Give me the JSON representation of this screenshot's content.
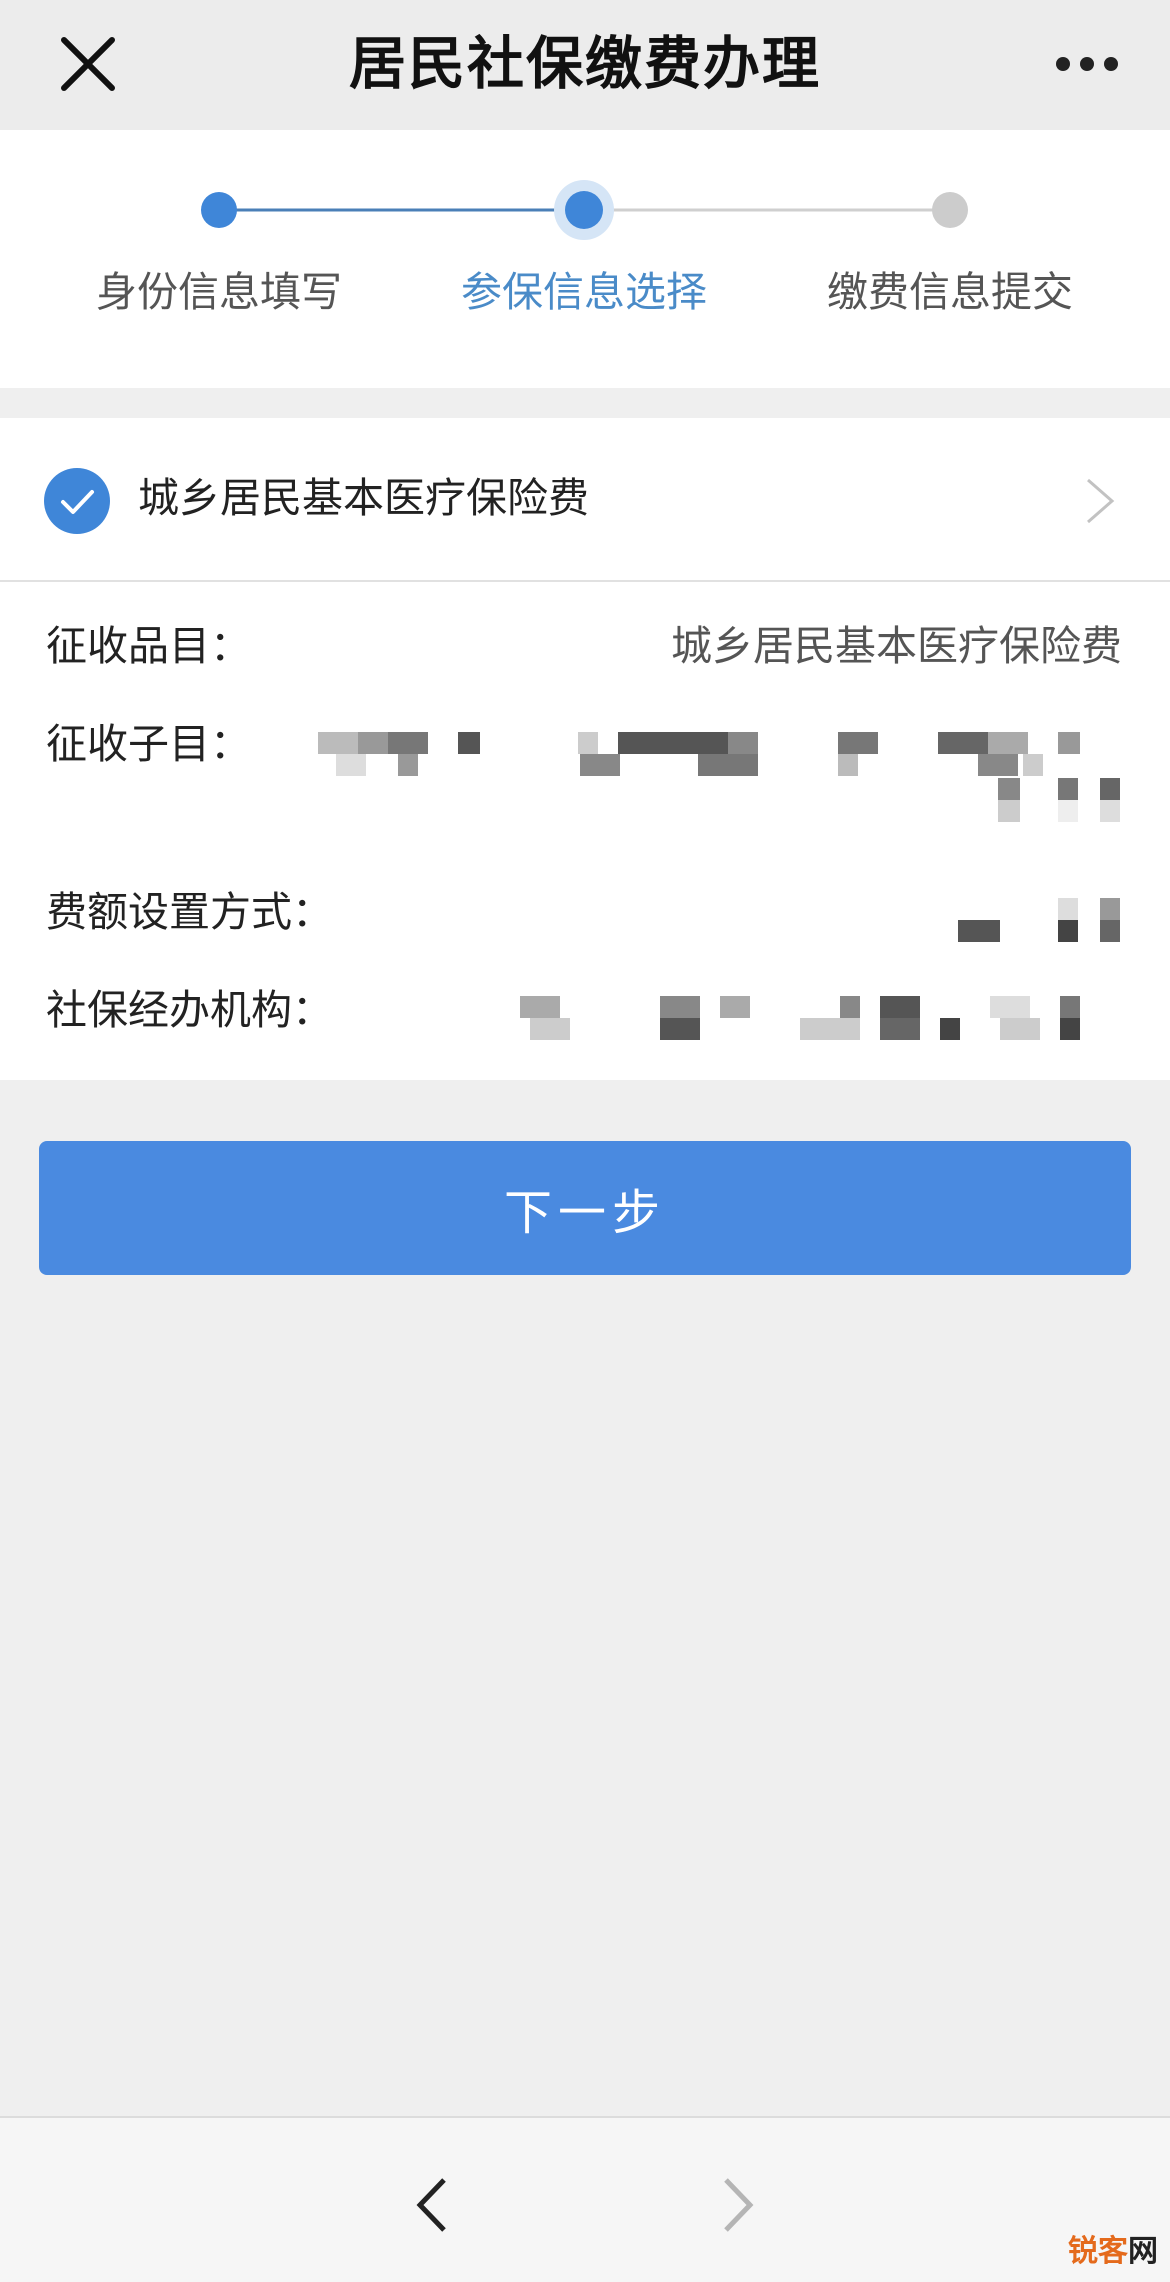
{
  "header": {
    "title": "居民社保缴费办理",
    "close_icon": "close-icon",
    "more_icon": "more-icon"
  },
  "stepper": {
    "steps": [
      {
        "label": "身份信息填写",
        "state": "done"
      },
      {
        "label": "参保信息选择",
        "state": "active"
      },
      {
        "label": "缴费信息提交",
        "state": "pending"
      }
    ],
    "active_color": "#4a8bc8",
    "pending_color": "#cccccc"
  },
  "selected_item": {
    "label": "城乡居民基本医疗保险费",
    "checked": true,
    "check_icon": "check-circle-icon",
    "chevron_icon": "chevron-right-icon"
  },
  "details": {
    "item_label": "征收品目：",
    "item_value": "城乡居民基本医疗保险费",
    "subitem_label": "征收子目：",
    "fee_method_label": "费额设置方式：",
    "agency_label": "社保经办机构："
  },
  "actions": {
    "next_label": "下一步",
    "button_color": "#4a8ae0"
  },
  "bottom_nav": {
    "back_icon": "chevron-left-icon",
    "forward_icon": "chevron-right-icon"
  },
  "watermark": {
    "part1": "锐客",
    "part2": "网"
  }
}
